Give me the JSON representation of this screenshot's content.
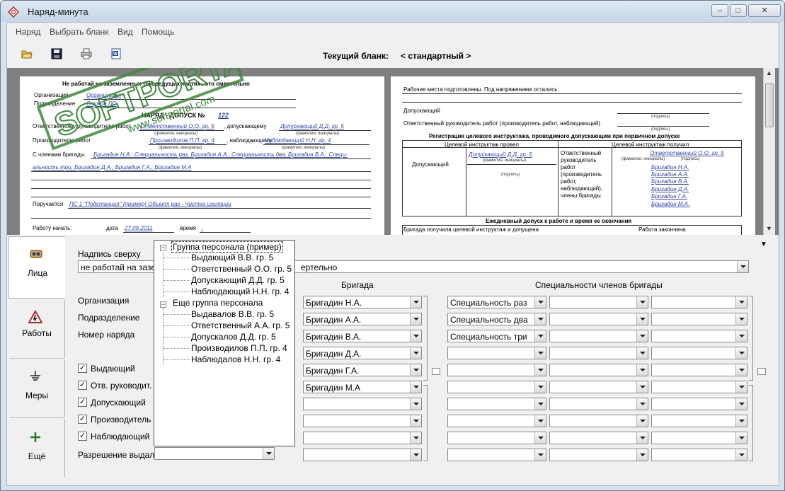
{
  "window": {
    "title": "Наряд-минута"
  },
  "menu": [
    "Наряд",
    "Выбрать бланк",
    "Вид",
    "Помощь"
  ],
  "toolbar": {
    "current_blank_label": "Текущий бланк:",
    "current_blank_value": "< стандартный >"
  },
  "watermark": {
    "brand": "SOFTPORTAL",
    "url": "www.softportal.com",
    "tm": "TM"
  },
  "preview_left": {
    "header": "Не работай на заземленных токоведущих частях - это смертельно",
    "org_label": "Организация",
    "org_value": "Организация",
    "div_label": "Подразделение",
    "div_value": "Служба ПС",
    "title": "НАРЯД - ДОПУСК №",
    "number": "122",
    "resp_label": "Ответственному руководителю работ",
    "resp_value": "Ответственный О.О. гр. 5",
    "adm_label": ", допускающему",
    "adm_value": "Допускающий Д.Д. гр. 5",
    "fio1": "(фамилия, инициалы)",
    "fio2": "(фамилия, инициалы)",
    "prod_label": "Производителю работ",
    "prod_value": "Производилов П.П. гр. 4",
    "obs_label": ", наблюдающему",
    "obs_value": "Наблюдающий Н.Н. гр. 4",
    "fio3": "(фамилия, инициалы)",
    "fio4": "(фамилия, инициалы)",
    "crew_label": "С членами бригады",
    "crew_value_1": "Бригадин Н.А.: Специальность раз, Бригадин А.А.: Специальность два, Бригадин В.А.: Специ-",
    "crew_value_2": "альность три, Бригадин Д.А., Бригадин Г.А., Бригадин М.А",
    "assign_label": "Поручается",
    "assign_value": "ПС 1 \"Подстанция\" (пример) Объект раз - Чистка изоляции",
    "start_label": "Работу начать:",
    "date_label": "дата",
    "date_value": "27.09.2011",
    "time_label": "время",
    "time_value": "-"
  },
  "preview_right": {
    "line1": "Рабочие места подготовлены. Под напряжением остались:",
    "admitter": "Допускающий",
    "sign1": "(подпись)",
    "resp_line": "Ответственный руководитель работ (производитель работ, наблюдающий)",
    "sign2": "(подпись)",
    "reg_title": "Регистрация целевого инструктажа, проводимого допускающим при первичном допуске",
    "col1": "Целевой инструктаж провел",
    "col2": "Целевой инструктаж получил",
    "admitter_cell": "Допускающий",
    "admitter_name": "Допускающий Д.Д. гр. 5",
    "fio_small": "(фамилия, инициалы)",
    "sign_small": "(подпись)",
    "resp_cell": "Ответственный руководитель работ (производитель работ, наблюдающий), члены бригады",
    "resp_name": "Ответственный О.О. гр. 5",
    "fio_small2": "(фамилия, инициалы)",
    "sign_small2": "(подпись)",
    "members": [
      "Бригадин Н.А.",
      "Бригадин А.А.",
      "Бригадин В.А.",
      "Бригадин Д.А.",
      "Бригадин Г.А.",
      "Бригадин М.А."
    ],
    "daily_title": "Ежедневный допуск к работе и время ее окончания",
    "daily_col1": "Бригада получила целевой инструктаж и допущена",
    "daily_col2": "Работа закончена"
  },
  "side_tabs": [
    {
      "label": "Лица",
      "icon": "people-icon"
    },
    {
      "label": "Работы",
      "icon": "warning-icon"
    },
    {
      "label": "Меры",
      "icon": "ground-icon"
    },
    {
      "label": "Ещё",
      "icon": "plus-icon"
    }
  ],
  "form": {
    "caption_label": "Надпись сверху",
    "caption_value": "не работай на зазе",
    "caption_value_tail": "ертельно",
    "brigade_header": "Бригада",
    "specialties_header": "Специальности членов бригады",
    "org_label": "Организация",
    "div_label": "Подразделение",
    "num_label": "Номер наряда",
    "issuer_label": "Выдающий",
    "resp_label": "Отв. руководит.",
    "admitter_label": "Допускающий",
    "producer_label": "Производитель",
    "observer_label": "Наблюдающий",
    "permit_label": "Разрешение выдал",
    "checkmark": "✓",
    "brigade": [
      "Бригадин Н.А.",
      "Бригадин А.А.",
      "Бригадин В.А.",
      "Бригадин Д.А.",
      "Бригадин Г.А.",
      "Бригадин М.А",
      "",
      "",
      "",
      ""
    ],
    "specialties": [
      "Специальность раз",
      "Специальность два",
      "Специальность три",
      "",
      "",
      "",
      "",
      "",
      "",
      ""
    ]
  },
  "tree": {
    "group1": "Группа персонала (пример)",
    "group1_items": [
      "Выдающий В.В. гр. 5",
      "Ответственный О.О. гр. 5",
      "Допускающий Д.Д. гр. 5",
      "Наблюдающий Н.Н. гр. 4"
    ],
    "group2": "Еще группа персонала",
    "group2_items": [
      "Выдавалов В.В. гр. 5",
      "Ответственный А.А. гр. 5",
      "Допускалов Д.Д. гр. 5",
      "Производилов П.П. гр. 4",
      "Наблюдалов Н.Н. гр. 4"
    ],
    "toggle": "−"
  },
  "colors": {
    "link_blue": "#3545a6",
    "stamp_green": "#3d8a3d"
  }
}
